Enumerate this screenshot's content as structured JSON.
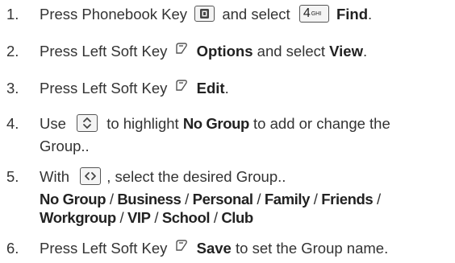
{
  "steps": [
    {
      "num": "1.",
      "parts": [
        "Press Phonebook Key",
        "and select",
        "Find",
        "."
      ],
      "key_label": "4",
      "key_sub": "GHI"
    },
    {
      "num": "2.",
      "parts": [
        "Press Left Soft Key",
        "Options",
        "and select",
        "View",
        "."
      ]
    },
    {
      "num": "3.",
      "parts": [
        "Press Left Soft Key",
        "Edit",
        "."
      ]
    },
    {
      "num": "4.",
      "parts": [
        "Use",
        "to highlight",
        "No Group",
        "to add or change the"
      ],
      "line2": "Group.."
    },
    {
      "num": "5.",
      "parts": [
        "With",
        ", select the desired Group.."
      ],
      "groups_line1": [
        "No Group",
        "Business",
        "Personal",
        "Family",
        "Friends"
      ],
      "groups_line2": [
        "Workgroup",
        "VIP",
        "School",
        "Club"
      ],
      "separator": " / "
    },
    {
      "num": "6.",
      "parts": [
        "Press Left Soft Key",
        "Save",
        "to set the Group name."
      ]
    }
  ],
  "icons": {
    "phonebook_key": "phonebook-key-icon",
    "left_soft_key": "left-soft-key-icon",
    "nav_up_down": "nav-up-down-key-icon",
    "nav_left_right": "nav-left-right-key-icon"
  }
}
